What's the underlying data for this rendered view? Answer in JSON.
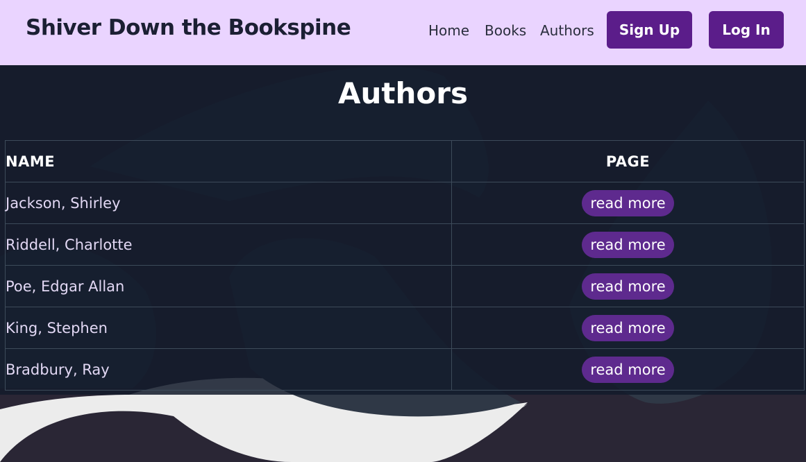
{
  "header": {
    "brand": "Shiver Down the Bookspine",
    "nav": [
      "Home",
      "Books",
      "Authors"
    ],
    "signup_label": "Sign Up",
    "login_label": "Log In"
  },
  "page": {
    "title": "Authors",
    "columns": {
      "name": "NAME",
      "page": "PAGE"
    },
    "rows": [
      {
        "name": "Jackson, Shirley",
        "action": "read more"
      },
      {
        "name": "Riddell, Charlotte",
        "action": "read more"
      },
      {
        "name": "Poe, Edgar Allan",
        "action": "read more"
      },
      {
        "name": "King, Stephen",
        "action": "read more"
      },
      {
        "name": "Bradbury, Ray",
        "action": "read more"
      }
    ]
  },
  "colors": {
    "navbar_bg": "#ead4ff",
    "accent": "#5b1d8a",
    "pill": "#5e2a8e",
    "page_bg": "#2a2635",
    "panel_bg": "#131b2b"
  },
  "background": {
    "decoration": "ghost-pattern"
  }
}
